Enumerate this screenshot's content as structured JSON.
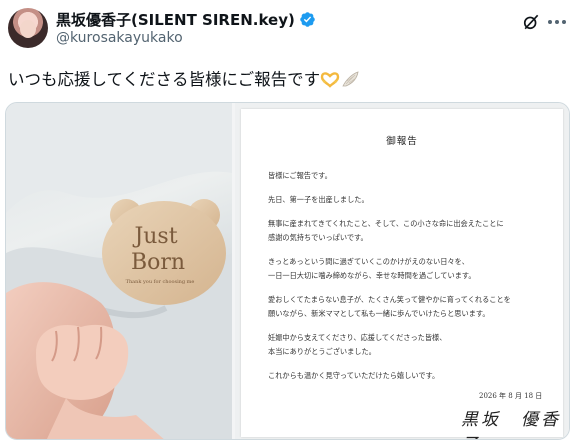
{
  "author": {
    "display_name": "黒坂優香子(SILENT SIREN.key)",
    "handle": "@kurosakayukako"
  },
  "icons": {
    "avatar": "profile-avatar",
    "verified": "verified-badge-icon",
    "grok": "grok-icon",
    "more": "more-options-icon"
  },
  "colors": {
    "verified_blue": "#1d9bf0",
    "secondary_text": "#536471",
    "border": "#cfd9de"
  },
  "tweet": {
    "text": "いつも応援してくださる皆様にご報告です",
    "emojis": [
      "heart-hands-emoji",
      "wing-emoji"
    ]
  },
  "media": {
    "photo": {
      "plaque_line1": "Just",
      "plaque_line2": "Born",
      "plaque_small": "Thank you for choosing me"
    },
    "document": {
      "title": "御報告",
      "lines": [
        "皆様にご報告です。",
        "先日、第一子を出産しました。",
        "無事に産まれてきてくれたこと、そして、この小さな命に出会えたことに",
        "感謝の気持ちでいっぱいです。",
        "きっとあっという間に過ぎていくこのかけがえのない日々を、",
        "一日一日大切に噛み締めながら、幸せな時間を過ごしています。",
        "愛おしくてたまらない息子が、たくさん笑って健やかに育ってくれることを",
        "願いながら、新米ママとして私も一緒に歩んでいけたらと思います。",
        "妊娠中から支えてくださり、応援してくださった皆様、",
        "本当にありがとうございました。",
        "これからも温かく見守っていただけたら嬉しいです。"
      ],
      "date": "2026 年 8 月 18 日",
      "signature": "黒坂　優香子"
    }
  }
}
